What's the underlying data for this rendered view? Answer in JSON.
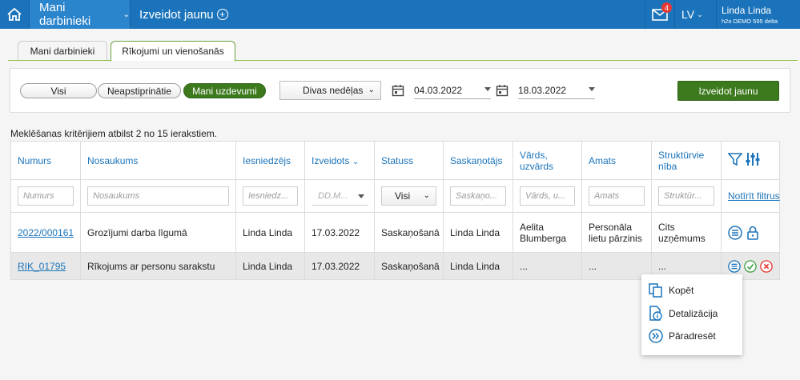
{
  "topbar": {
    "menu_my_employees": "Mani darbinieki",
    "menu_create_new": "Izveidot jaunu",
    "mail_badge": "4",
    "language": "LV",
    "user_name": "Linda Linda",
    "user_org": "h2o DEMO 595 delta"
  },
  "tabs": [
    {
      "label": "Mani darbinieki"
    },
    {
      "label": "Rīkojumi un vienošanās"
    }
  ],
  "filters": {
    "pills": [
      "Visi",
      "Neapstiprinātie",
      "Mani uzdevumi"
    ],
    "period": "Divas nedēļas",
    "date_from": "04.03.2022",
    "date_to": "18.03.2022",
    "create_button": "Izveidot jaunu"
  },
  "results_info": "Meklēšanas kritērijiem atbilst 2 no 15 ierakstiem.",
  "table": {
    "headers": {
      "number": "Numurs",
      "title": "Nosaukums",
      "submitter": "Iesniedzējs",
      "created": "Izveidots",
      "status": "Statuss",
      "approver": "Saskaņotājs",
      "name_line1": "Vārds,",
      "name_line2": "uzvārds",
      "position": "Amats",
      "unit_line1": "Struktūrvie",
      "unit_line2": "nība"
    },
    "filter_placeholders": {
      "number": "Numurs",
      "title": "Nosaukums",
      "submitter": "Iesniedz...",
      "created": "DD.M...",
      "status": "Visi",
      "approver": "Saskaņo...",
      "name": "Vārds, u...",
      "position": "Amats",
      "unit": "Struktūr...",
      "clear": "Notīrīt filtrus"
    },
    "rows": [
      {
        "number": "2022/000161",
        "title": "Grozījumi darba līgumā",
        "submitter": "Linda Linda",
        "created": "17.03.2022",
        "status": "Saskaņošanā",
        "approver": "Linda Linda",
        "name": "Aelita Blumberga",
        "position": "Personāla lietu pārzinis",
        "unit": "Cits uzņēmums"
      },
      {
        "number": "RIK_01795",
        "title": "Rīkojums ar personu sarakstu",
        "submitter": "Linda Linda",
        "created": "17.03.2022",
        "status": "Saskaņošanā",
        "approver": "Linda Linda",
        "name": "...",
        "position": "...",
        "unit": "..."
      }
    ]
  },
  "popup": {
    "copy": "Kopēt",
    "details": "Detalizācija",
    "redirect": "Pāradresēt"
  },
  "colors": {
    "topbar": "#1b74bb",
    "accent_green": "#3d7a1e",
    "link_blue": "#1b74bb",
    "approve_green": "#43a047",
    "reject_red": "#e53935"
  }
}
